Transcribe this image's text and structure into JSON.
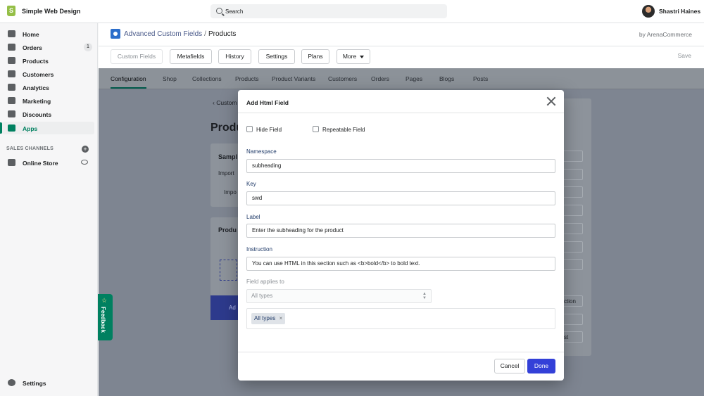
{
  "topbar": {
    "store_name": "Simple Web Design",
    "search_placeholder": "Search",
    "user_name": "Shastri Haines"
  },
  "sidebar": {
    "items": [
      {
        "label": "Home",
        "icon": "home-icon"
      },
      {
        "label": "Orders",
        "icon": "orders-icon",
        "badge": "1"
      },
      {
        "label": "Products",
        "icon": "tag-icon"
      },
      {
        "label": "Customers",
        "icon": "person-icon"
      },
      {
        "label": "Analytics",
        "icon": "bar-chart-icon"
      },
      {
        "label": "Marketing",
        "icon": "megaphone-icon"
      },
      {
        "label": "Discounts",
        "icon": "discount-icon"
      },
      {
        "label": "Apps",
        "icon": "apps-icon",
        "active": true
      }
    ],
    "sales_channels_heading": "SALES CHANNELS",
    "online_store": "Online Store",
    "settings": "Settings"
  },
  "app_header": {
    "breadcrumb_app": "Advanced Custom Fields",
    "breadcrumb_sep": "/",
    "breadcrumb_current": "Products",
    "byline": "by ArenaCommerce",
    "toolbar": {
      "custom_fields": "Custom Fields",
      "metafields": "Metafields",
      "history": "History",
      "settings": "Settings",
      "plans": "Plans",
      "more": "More",
      "save": "Save"
    }
  },
  "tabs": [
    "Configuration",
    "Shop",
    "Collections",
    "Products",
    "Product Variants",
    "Customers",
    "Orders",
    "Pages",
    "Blogs",
    "Posts"
  ],
  "background": {
    "back_link": "Custom",
    "title": "Produ",
    "card1_title": "Sampl",
    "card1_text": "Import",
    "card1_button": "Impo",
    "card2_title": "Produ",
    "blue_bar_text": "Ad",
    "right_text_1": "ction",
    "right_text_2": "st"
  },
  "feedback": "Feedback",
  "modal": {
    "title": "Add Html Field",
    "hide_field": "Hide Field",
    "repeatable_field": "Repeatable Field",
    "namespace_label": "Namespace",
    "namespace_value": "subheading",
    "key_label": "Key",
    "key_value": "swd",
    "label_label": "Label",
    "label_value": "Enter the subheading for the product",
    "instruction_label": "Instruction",
    "instruction_value": "You can use HTML in this section such as <b>bold</b> to bold text.",
    "applies_label": "Field applies to",
    "select_placeholder": "All types",
    "tag": "All types",
    "tag_remove": "×",
    "cancel": "Cancel",
    "done": "Done"
  },
  "colors": {
    "primary": "#3340d8",
    "shopify_green": "#008060",
    "overlay": "#7e8591"
  }
}
